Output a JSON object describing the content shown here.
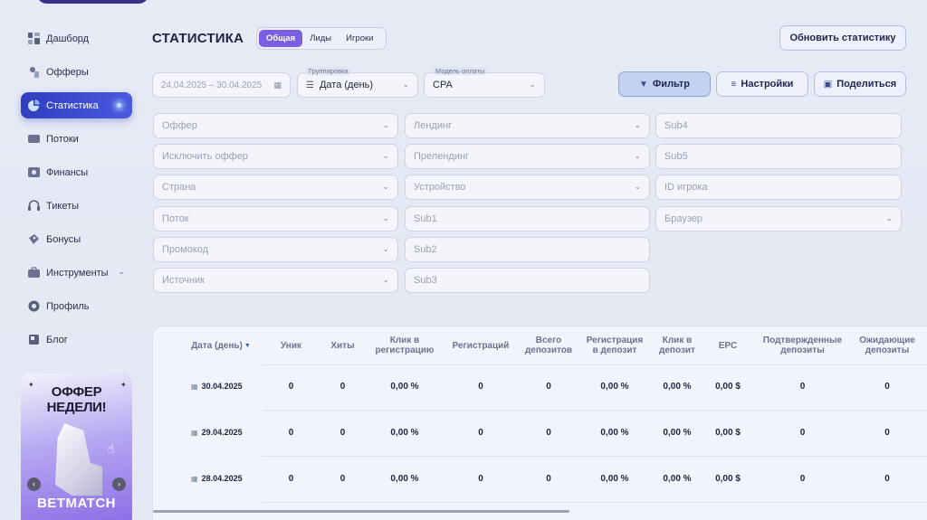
{
  "sidebar": {
    "items": [
      {
        "label": "Дашборд",
        "icon": "dashboard-icon"
      },
      {
        "label": "Офферы",
        "icon": "offers-icon"
      },
      {
        "label": "Статистика",
        "icon": "statistics-icon",
        "active": true
      },
      {
        "label": "Потоки",
        "icon": "flows-icon"
      },
      {
        "label": "Финансы",
        "icon": "finance-icon"
      },
      {
        "label": "Тикеты",
        "icon": "headset-icon"
      },
      {
        "label": "Бонусы",
        "icon": "bonus-icon"
      },
      {
        "label": "Инструменты",
        "icon": "tools-icon"
      },
      {
        "label": "Профиль",
        "icon": "profile-icon"
      },
      {
        "label": "Блог",
        "icon": "blog-icon"
      }
    ],
    "promo": {
      "title_line1": "ОФФЕР",
      "title_line2": "НЕДЕЛИ!",
      "brand": "BETMATCH"
    }
  },
  "header": {
    "title": "СТАТИСТИКА",
    "tabs": [
      "Общая",
      "Лиды",
      "Игроки"
    ],
    "refresh_label": "Обновить статистику"
  },
  "controls": {
    "date_range": "24.04.2025 – 30.04.2025",
    "grouping_legend": "Группировка",
    "grouping_value": "Дата (день)",
    "payment_legend": "Модель оплаты",
    "payment_value": "CPA",
    "filter_label": "Фильтр",
    "settings_label": "Настройки",
    "share_label": "Поделиться"
  },
  "filters": {
    "offer": "Оффер",
    "exclude_offer": "Исключить оффер",
    "country": "Страна",
    "flow": "Поток",
    "promocode": "Промокод",
    "source": "Источник",
    "landing": "Лендинг",
    "prelanding": "Прелендинг",
    "device": "Устройство",
    "sub1": "Sub1",
    "sub2": "Sub2",
    "sub3": "Sub3",
    "sub4": "Sub4",
    "sub5": "Sub5",
    "player_id": "ID игрока",
    "browser": "Браузер"
  },
  "table": {
    "headers": {
      "date": "Дата (день)",
      "uniq": "Уник",
      "hits": "Хиты",
      "click_reg_1": "Клик в",
      "click_reg_2": "регистрацию",
      "regs": "Регистраций",
      "deps_1": "Всего",
      "deps_2": "депозитов",
      "reg_dep_1": "Регистрация",
      "reg_dep_2": "в депозит",
      "click_dep_1": "Клик в",
      "click_dep_2": "депозит",
      "epc": "EPC",
      "confirmed_1": "Подтвержденные",
      "confirmed_2": "депозиты",
      "pending_1": "Ожидающие",
      "pending_2": "депозиты"
    },
    "rows": [
      {
        "date": "30.04.2025",
        "uniq": "0",
        "hits": "0",
        "click_reg": "0,00 %",
        "regs": "0",
        "deps": "0",
        "reg_dep": "0,00 %",
        "click_dep": "0,00 %",
        "epc": "0,00 $",
        "confirmed": "0",
        "pending": "0"
      },
      {
        "date": "29.04.2025",
        "uniq": "0",
        "hits": "0",
        "click_reg": "0,00 %",
        "regs": "0",
        "deps": "0",
        "reg_dep": "0,00 %",
        "click_dep": "0,00 %",
        "epc": "0,00 $",
        "confirmed": "0",
        "pending": "0"
      },
      {
        "date": "28.04.2025",
        "uniq": "0",
        "hits": "0",
        "click_reg": "0,00 %",
        "regs": "0",
        "deps": "0",
        "reg_dep": "0,00 %",
        "click_dep": "0,00 %",
        "epc": "0,00 $",
        "confirmed": "0",
        "pending": "0"
      }
    ]
  }
}
